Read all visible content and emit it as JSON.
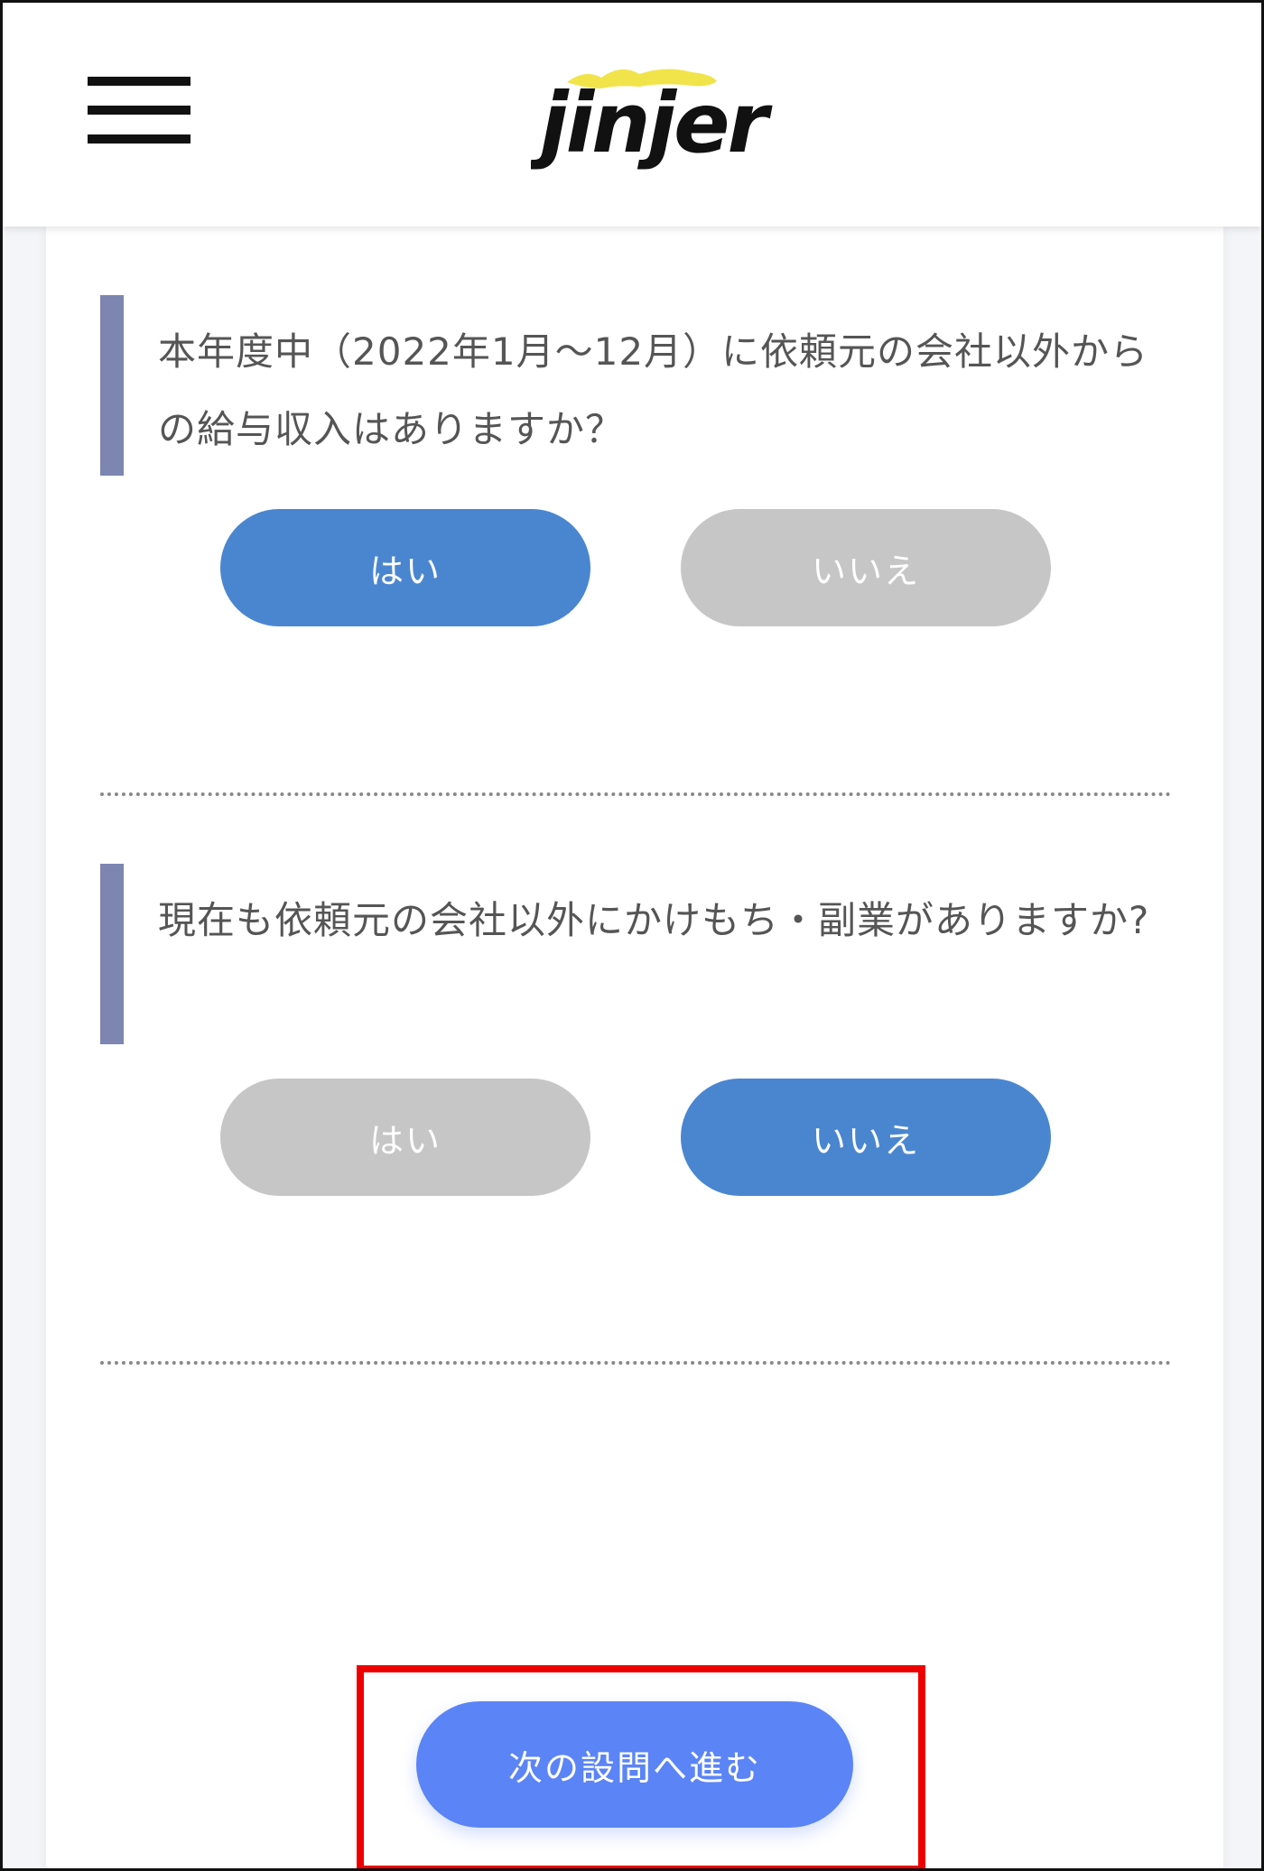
{
  "header": {
    "logo_text": "jinjer",
    "menu_icon": "hamburger-menu-icon"
  },
  "questions": [
    {
      "text": "本年度中（2022年1月〜12月）に依頼元の会社以外からの給与収入はありますか？",
      "yes_label": "はい",
      "no_label": "いいえ",
      "selected": "yes"
    },
    {
      "text": "現在も依頼元の会社以外にかけもち・副業がありますか?",
      "yes_label": "はい",
      "no_label": "いいえ",
      "selected": "no"
    }
  ],
  "next_button_label": "次の設問へ進む",
  "colors": {
    "selected": "#4a86d0",
    "unselected": "#c6c6c6",
    "question_bar": "#7d85b1",
    "next_button": "#5b84f6",
    "highlight": "#ee0000",
    "logo_yellow": "#f0e44a"
  }
}
